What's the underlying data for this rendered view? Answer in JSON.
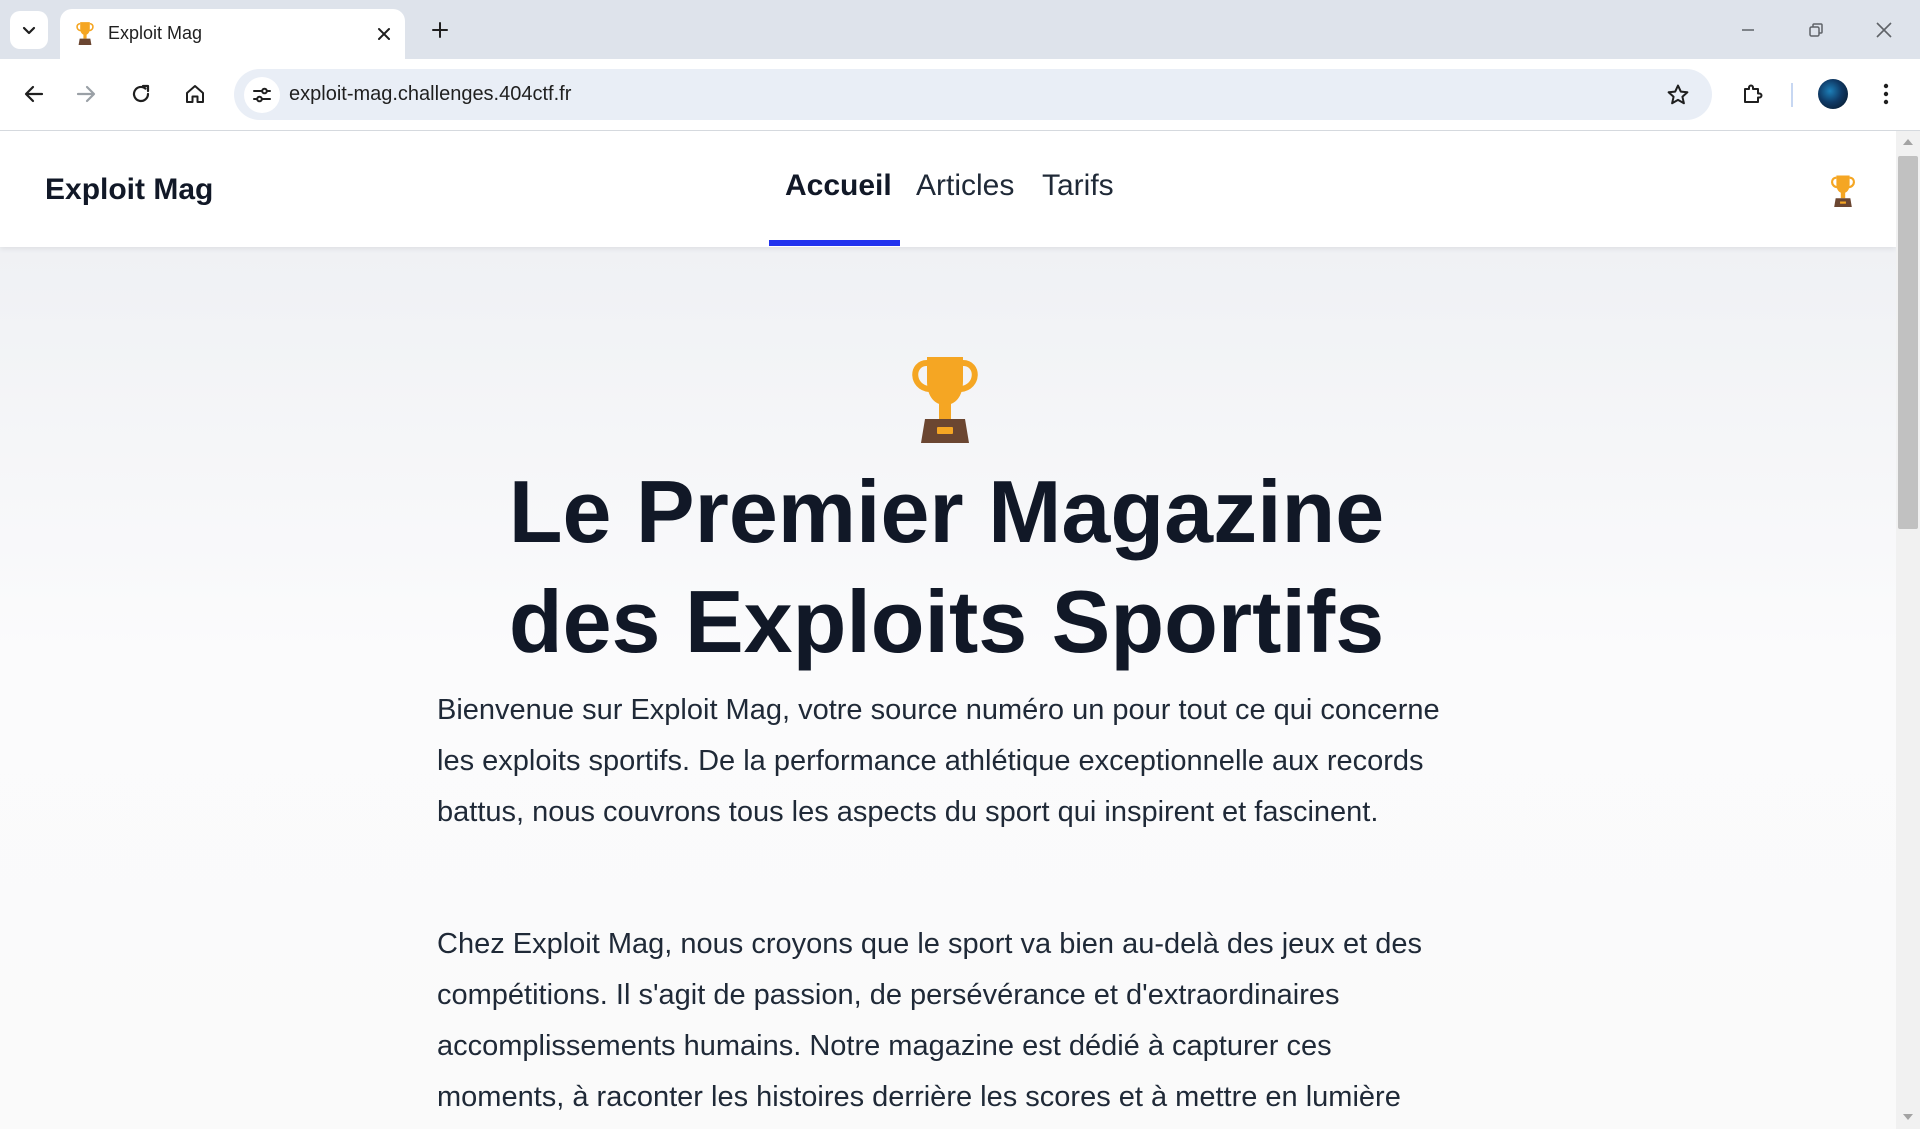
{
  "browser": {
    "tab": {
      "title": "Exploit Mag"
    },
    "address_bar": {
      "url": "exploit-mag.challenges.404ctf.fr"
    },
    "icons": [
      "tab-search-icon",
      "trophy-favicon-icon",
      "close-icon",
      "plus-icon",
      "minimize-icon",
      "restore-icon",
      "window-close-icon",
      "back-icon",
      "forward-icon",
      "reload-icon",
      "home-icon",
      "site-info-icon",
      "bookmark-star-icon",
      "extensions-icon",
      "profile-avatar",
      "more-menu-icon"
    ]
  },
  "site": {
    "brand": "Exploit Mag",
    "nav": [
      {
        "label": "Accueil",
        "active": true
      },
      {
        "label": "Articles",
        "active": false
      },
      {
        "label": "Tarifs",
        "active": false
      }
    ],
    "accent_color": "#2233ee"
  },
  "hero": {
    "title_line1": "Le Premier Magazine",
    "title_line2": "des Exploits Sportifs",
    "paragraphs": [
      "Bienvenue sur Exploit Mag, votre source numéro un pour tout ce qui concerne les exploits sportifs. De la performance athlétique exceptionnelle aux records battus, nous couvrons tous les aspects du sport qui inspirent et fascinent.",
      "Chez Exploit Mag, nous croyons que le sport va bien au-delà des jeux et des compétitions. Il s'agit de passion, de persévérance et d'extraordinaires accomplissements humains. Notre magazine est dédié à capturer ces moments, à raconter les histoires derrière les scores et à mettre en lumière"
    ]
  }
}
